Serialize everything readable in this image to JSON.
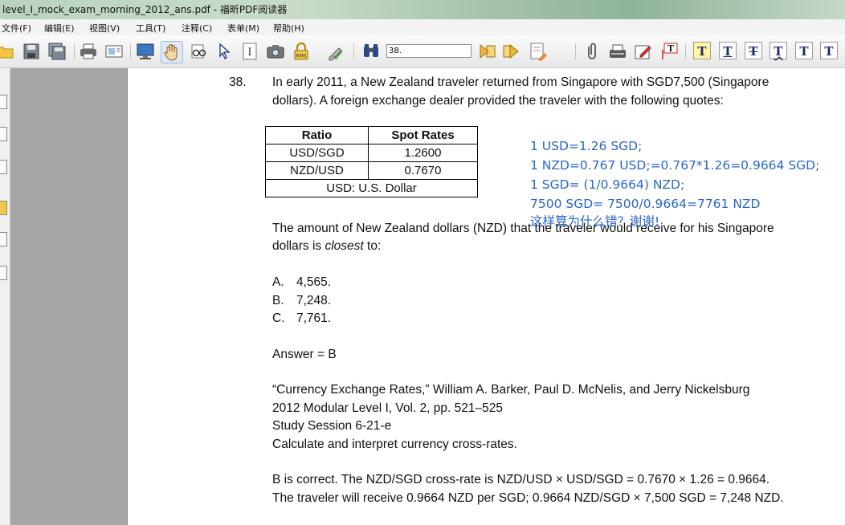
{
  "window": {
    "title": "level_I_mock_exam_morning_2012_ans.pdf - 福昕PDF阅读器"
  },
  "menu": [
    "文件(F)",
    "编辑(E)",
    "视图(V)",
    "工具(T)",
    "注释(C)",
    "表单(M)",
    "帮助(H)"
  ],
  "toolbar": {
    "search_value": "38.",
    "icons": [
      "open-icon",
      "save-icon",
      "save-all-icon",
      "print-icon",
      "page-setup-icon",
      "monitor-icon",
      "hand-tool-icon",
      "zoom-glasses-icon",
      "select-arrow-icon",
      "text-select-icon",
      "snapshot-camera-icon",
      "rms-lock-icon",
      "signature-icon",
      "find-binoculars-icon",
      "prev-result-icon",
      "next-result-icon",
      "highlight-page-icon",
      "attach-icon",
      "typewriter-icon",
      "note-pen-icon",
      "text-field-icon",
      "text-highlight-icon",
      "text-underline-icon",
      "text-strike-icon",
      "text-squiggly-icon",
      "text-replace-icon",
      "text-insert-icon"
    ]
  },
  "doc": {
    "question_number": "38.",
    "question_line1": "In early 2011, a New Zealand traveler returned from Singapore with SGD7,500 (Singapore",
    "question_line2": "dollars). A foreign exchange dealer provided the traveler with the following quotes:",
    "table": {
      "headers": [
        "Ratio",
        "Spot Rates"
      ],
      "rows": [
        [
          "USD/SGD",
          "1.2600"
        ],
        [
          "NZD/USD",
          "0.7670"
        ]
      ],
      "footer": "USD: U.S. Dollar"
    },
    "prompt_line1": "The amount of New Zealand dollars (NZD) that the traveler would receive for his Singapore",
    "prompt_line2_a": "dollars is ",
    "prompt_line2_em": "closest",
    "prompt_line2_b": " to:",
    "options": [
      {
        "letter": "A.",
        "value": "4,565."
      },
      {
        "letter": "B.",
        "value": "7,248."
      },
      {
        "letter": "C.",
        "value": "7,761."
      }
    ],
    "answer": "Answer = B",
    "reference": [
      "“Currency Exchange Rates,” William A. Barker, Paul D. McNelis, and Jerry Nickelsburg",
      "2012 Modular Level I, Vol. 2, pp. 521–525",
      "Study Session 6-21-e",
      "Calculate and interpret currency cross-rates."
    ],
    "explanation": [
      "B is correct. The NZD/SGD cross-rate is NZD/USD × USD/SGD = 0.7670 × 1.26 = 0.9664.",
      "The traveler will receive 0.9664 NZD per SGD; 0.9664 NZD/SGD × 7,500 SGD = 7,248 NZD."
    ]
  },
  "annotation": {
    "color": "#2a67c9",
    "lines": [
      "1 USD=1.26  SGD;",
      "1 NZD=0.767 USD;=0.767*1.26=0.9664 SGD;",
      "1 SGD= (1/0.9664) NZD;",
      "7500 SGD= 7500/0.9664=7761 NZD",
      "这样算为什么错？谢谢!"
    ]
  }
}
